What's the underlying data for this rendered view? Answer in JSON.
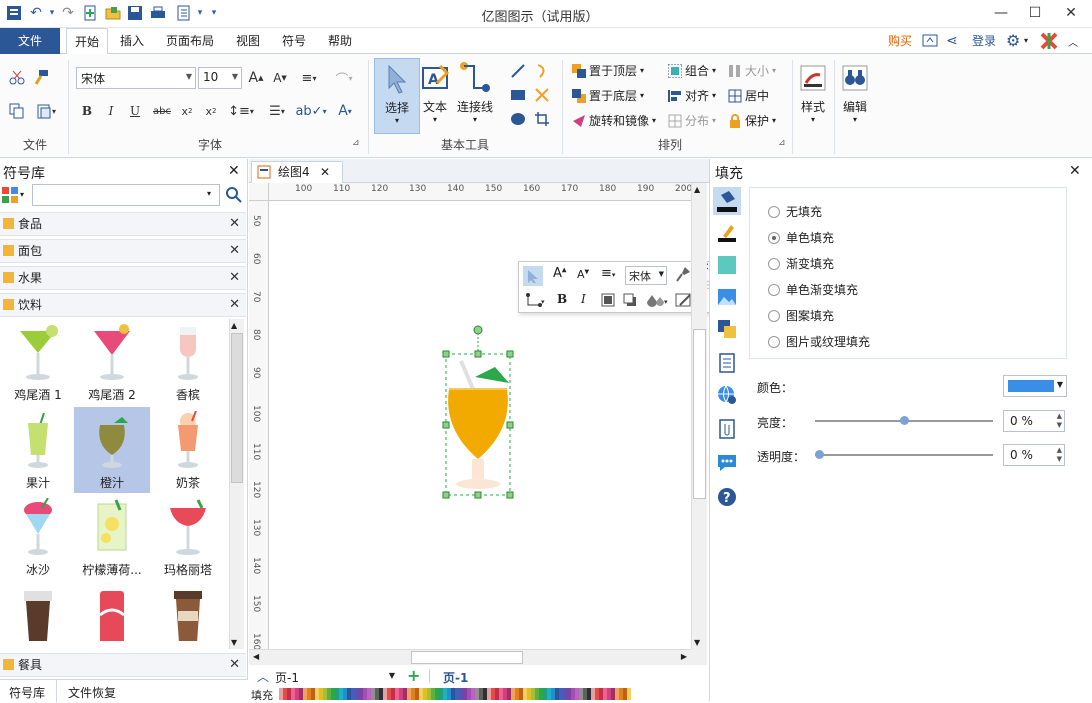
{
  "app": {
    "title": "亿图图示（试用版）"
  },
  "menu": {
    "file": "文件",
    "home": "开始",
    "insert": "插入",
    "layout": "页面布局",
    "view": "视图",
    "symbol": "符号",
    "help": "帮助",
    "buy": "购买",
    "login": "登录"
  },
  "ribbon": {
    "group_file": "文件",
    "group_font": "字体",
    "group_basic": "基本工具",
    "group_arrange": "排列",
    "font_name": "宋体",
    "font_size": "10",
    "select": "选择",
    "text": "文本",
    "connector": "连接线",
    "bring_front": "置于顶层",
    "send_back": "置于底层",
    "rotate_mirror": "旋转和镜像",
    "group": "组合",
    "align": "对齐",
    "distribute": "分布",
    "size": "大小",
    "center": "居中",
    "protect": "保护",
    "style": "样式",
    "edit": "编辑"
  },
  "library": {
    "title": "符号库",
    "search_placeholder": "",
    "categories": [
      "食品",
      "面包",
      "水果",
      "饮料"
    ],
    "bottom_category": "餐具",
    "symbols": [
      "鸡尾酒 1",
      "鸡尾酒 2",
      "香槟",
      "果汁",
      "橙汁",
      "奶茶",
      "冰沙",
      "柠檬薄荷...",
      "玛格丽塔"
    ],
    "selected": "橙汁",
    "bottom_tabs": [
      "符号库",
      "文件恢复"
    ]
  },
  "document": {
    "tab": "绘图4",
    "ruler_h": [
      "100",
      "110",
      "120",
      "130",
      "140",
      "150",
      "160",
      "170",
      "180",
      "190",
      "200"
    ],
    "ruler_v": [
      "50",
      "60",
      "70",
      "80",
      "90",
      "100",
      "110",
      "120",
      "130",
      "140",
      "150",
      "160"
    ],
    "page_select": "页-1",
    "page_tab": "页-1",
    "fill_label": "填充",
    "float_font": "宋体"
  },
  "fill_panel": {
    "title": "填充",
    "options": [
      "无填充",
      "单色填充",
      "渐变填充",
      "单色渐变填充",
      "图案填充",
      "图片或纹理填充"
    ],
    "selected_index": 1,
    "color_label": "颜色：",
    "color_value": "#3a8ee6",
    "brightness_label": "亮度：",
    "brightness_value": "0 %",
    "transparency_label": "透明度：",
    "transparency_value": "0 %"
  },
  "colors": {
    "accent": "#2b5797",
    "orange": "#f2a900"
  }
}
